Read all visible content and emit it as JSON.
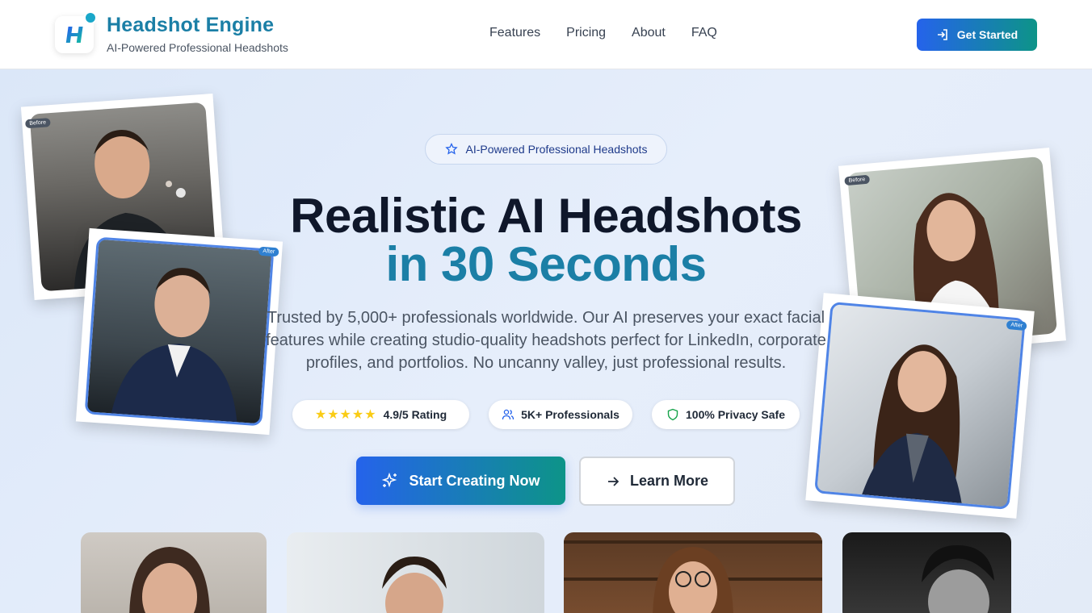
{
  "header": {
    "brand_title": "Headshot Engine",
    "brand_subtitle": "AI-Powered Professional Headshots",
    "logo_letter": "H",
    "nav": [
      "Features",
      "Pricing",
      "About",
      "FAQ"
    ],
    "cta": "Get Started",
    "icons": {
      "logo": "h-logo-icon",
      "cta": "sign-in-icon"
    }
  },
  "hero": {
    "badge": "AI-Powered Professional Headshots",
    "headline_line1": "Realistic AI Headshots",
    "headline_line2": "in 30 Seconds",
    "description": "Trusted by 5,000+ professionals worldwide. Our AI preserves your exact facial features while creating studio-quality headshots perfect for LinkedIn, corporate profiles, and portfolios. No uncanny valley, just professional results.",
    "stats": {
      "rating": "4.9/5 Rating",
      "stars": "★★★★★",
      "professionals": "5K+ Professionals",
      "privacy": "100% Privacy Safe"
    },
    "primary_cta": "Start Creating Now",
    "secondary_cta": "Learn More"
  },
  "photo_cards": [
    {
      "tag": "Before"
    },
    {
      "tag": "After"
    },
    {
      "tag": "Before"
    },
    {
      "tag": "After"
    }
  ],
  "colors": {
    "brand": "#1b7fa6",
    "primary_blue": "#2563eb",
    "teal": "#0d9488",
    "headline_dark": "#0f172a"
  }
}
